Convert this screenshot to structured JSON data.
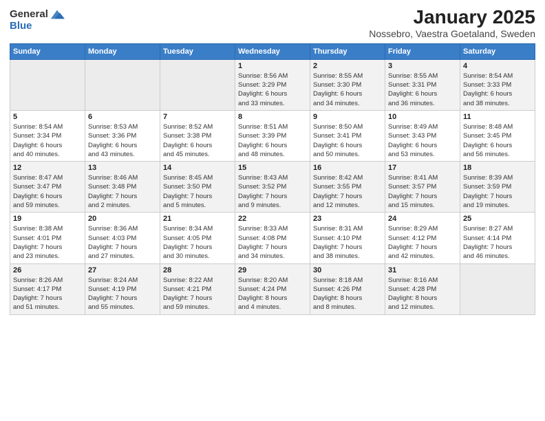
{
  "logo": {
    "general": "General",
    "blue": "Blue"
  },
  "title": "January 2025",
  "subtitle": "Nossebro, Vaestra Goetaland, Sweden",
  "weekdays": [
    "Sunday",
    "Monday",
    "Tuesday",
    "Wednesday",
    "Thursday",
    "Friday",
    "Saturday"
  ],
  "weeks": [
    [
      {
        "num": "",
        "info": ""
      },
      {
        "num": "",
        "info": ""
      },
      {
        "num": "",
        "info": ""
      },
      {
        "num": "1",
        "info": "Sunrise: 8:56 AM\nSunset: 3:29 PM\nDaylight: 6 hours\nand 33 minutes."
      },
      {
        "num": "2",
        "info": "Sunrise: 8:55 AM\nSunset: 3:30 PM\nDaylight: 6 hours\nand 34 minutes."
      },
      {
        "num": "3",
        "info": "Sunrise: 8:55 AM\nSunset: 3:31 PM\nDaylight: 6 hours\nand 36 minutes."
      },
      {
        "num": "4",
        "info": "Sunrise: 8:54 AM\nSunset: 3:33 PM\nDaylight: 6 hours\nand 38 minutes."
      }
    ],
    [
      {
        "num": "5",
        "info": "Sunrise: 8:54 AM\nSunset: 3:34 PM\nDaylight: 6 hours\nand 40 minutes."
      },
      {
        "num": "6",
        "info": "Sunrise: 8:53 AM\nSunset: 3:36 PM\nDaylight: 6 hours\nand 43 minutes."
      },
      {
        "num": "7",
        "info": "Sunrise: 8:52 AM\nSunset: 3:38 PM\nDaylight: 6 hours\nand 45 minutes."
      },
      {
        "num": "8",
        "info": "Sunrise: 8:51 AM\nSunset: 3:39 PM\nDaylight: 6 hours\nand 48 minutes."
      },
      {
        "num": "9",
        "info": "Sunrise: 8:50 AM\nSunset: 3:41 PM\nDaylight: 6 hours\nand 50 minutes."
      },
      {
        "num": "10",
        "info": "Sunrise: 8:49 AM\nSunset: 3:43 PM\nDaylight: 6 hours\nand 53 minutes."
      },
      {
        "num": "11",
        "info": "Sunrise: 8:48 AM\nSunset: 3:45 PM\nDaylight: 6 hours\nand 56 minutes."
      }
    ],
    [
      {
        "num": "12",
        "info": "Sunrise: 8:47 AM\nSunset: 3:47 PM\nDaylight: 6 hours\nand 59 minutes."
      },
      {
        "num": "13",
        "info": "Sunrise: 8:46 AM\nSunset: 3:48 PM\nDaylight: 7 hours\nand 2 minutes."
      },
      {
        "num": "14",
        "info": "Sunrise: 8:45 AM\nSunset: 3:50 PM\nDaylight: 7 hours\nand 5 minutes."
      },
      {
        "num": "15",
        "info": "Sunrise: 8:43 AM\nSunset: 3:52 PM\nDaylight: 7 hours\nand 9 minutes."
      },
      {
        "num": "16",
        "info": "Sunrise: 8:42 AM\nSunset: 3:55 PM\nDaylight: 7 hours\nand 12 minutes."
      },
      {
        "num": "17",
        "info": "Sunrise: 8:41 AM\nSunset: 3:57 PM\nDaylight: 7 hours\nand 15 minutes."
      },
      {
        "num": "18",
        "info": "Sunrise: 8:39 AM\nSunset: 3:59 PM\nDaylight: 7 hours\nand 19 minutes."
      }
    ],
    [
      {
        "num": "19",
        "info": "Sunrise: 8:38 AM\nSunset: 4:01 PM\nDaylight: 7 hours\nand 23 minutes."
      },
      {
        "num": "20",
        "info": "Sunrise: 8:36 AM\nSunset: 4:03 PM\nDaylight: 7 hours\nand 27 minutes."
      },
      {
        "num": "21",
        "info": "Sunrise: 8:34 AM\nSunset: 4:05 PM\nDaylight: 7 hours\nand 30 minutes."
      },
      {
        "num": "22",
        "info": "Sunrise: 8:33 AM\nSunset: 4:08 PM\nDaylight: 7 hours\nand 34 minutes."
      },
      {
        "num": "23",
        "info": "Sunrise: 8:31 AM\nSunset: 4:10 PM\nDaylight: 7 hours\nand 38 minutes."
      },
      {
        "num": "24",
        "info": "Sunrise: 8:29 AM\nSunset: 4:12 PM\nDaylight: 7 hours\nand 42 minutes."
      },
      {
        "num": "25",
        "info": "Sunrise: 8:27 AM\nSunset: 4:14 PM\nDaylight: 7 hours\nand 46 minutes."
      }
    ],
    [
      {
        "num": "26",
        "info": "Sunrise: 8:26 AM\nSunset: 4:17 PM\nDaylight: 7 hours\nand 51 minutes."
      },
      {
        "num": "27",
        "info": "Sunrise: 8:24 AM\nSunset: 4:19 PM\nDaylight: 7 hours\nand 55 minutes."
      },
      {
        "num": "28",
        "info": "Sunrise: 8:22 AM\nSunset: 4:21 PM\nDaylight: 7 hours\nand 59 minutes."
      },
      {
        "num": "29",
        "info": "Sunrise: 8:20 AM\nSunset: 4:24 PM\nDaylight: 8 hours\nand 4 minutes."
      },
      {
        "num": "30",
        "info": "Sunrise: 8:18 AM\nSunset: 4:26 PM\nDaylight: 8 hours\nand 8 minutes."
      },
      {
        "num": "31",
        "info": "Sunrise: 8:16 AM\nSunset: 4:28 PM\nDaylight: 8 hours\nand 12 minutes."
      },
      {
        "num": "",
        "info": ""
      }
    ]
  ]
}
